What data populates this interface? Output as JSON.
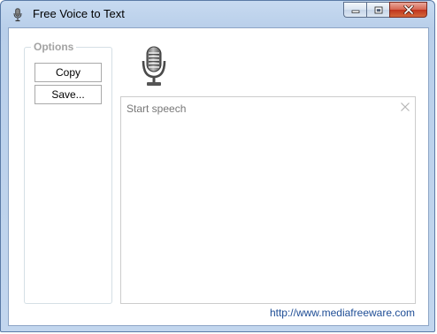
{
  "window": {
    "title": "Free Voice to Text",
    "icon": "microphone-icon",
    "controls": {
      "minimize": "minimize-icon",
      "maximize": "maximize-icon",
      "close": "close-icon"
    }
  },
  "options": {
    "legend": "Options",
    "copy_label": "Copy",
    "save_label": "Save..."
  },
  "main": {
    "mic_icon": "microphone-icon",
    "speech_placeholder": "Start speech",
    "clear_icon": "clear-icon"
  },
  "footer": {
    "link_text": "http://www.mediafreeware.com"
  },
  "colors": {
    "link": "#1f4e96",
    "close_button": "#c0341d",
    "frame": "#b9cfea"
  }
}
